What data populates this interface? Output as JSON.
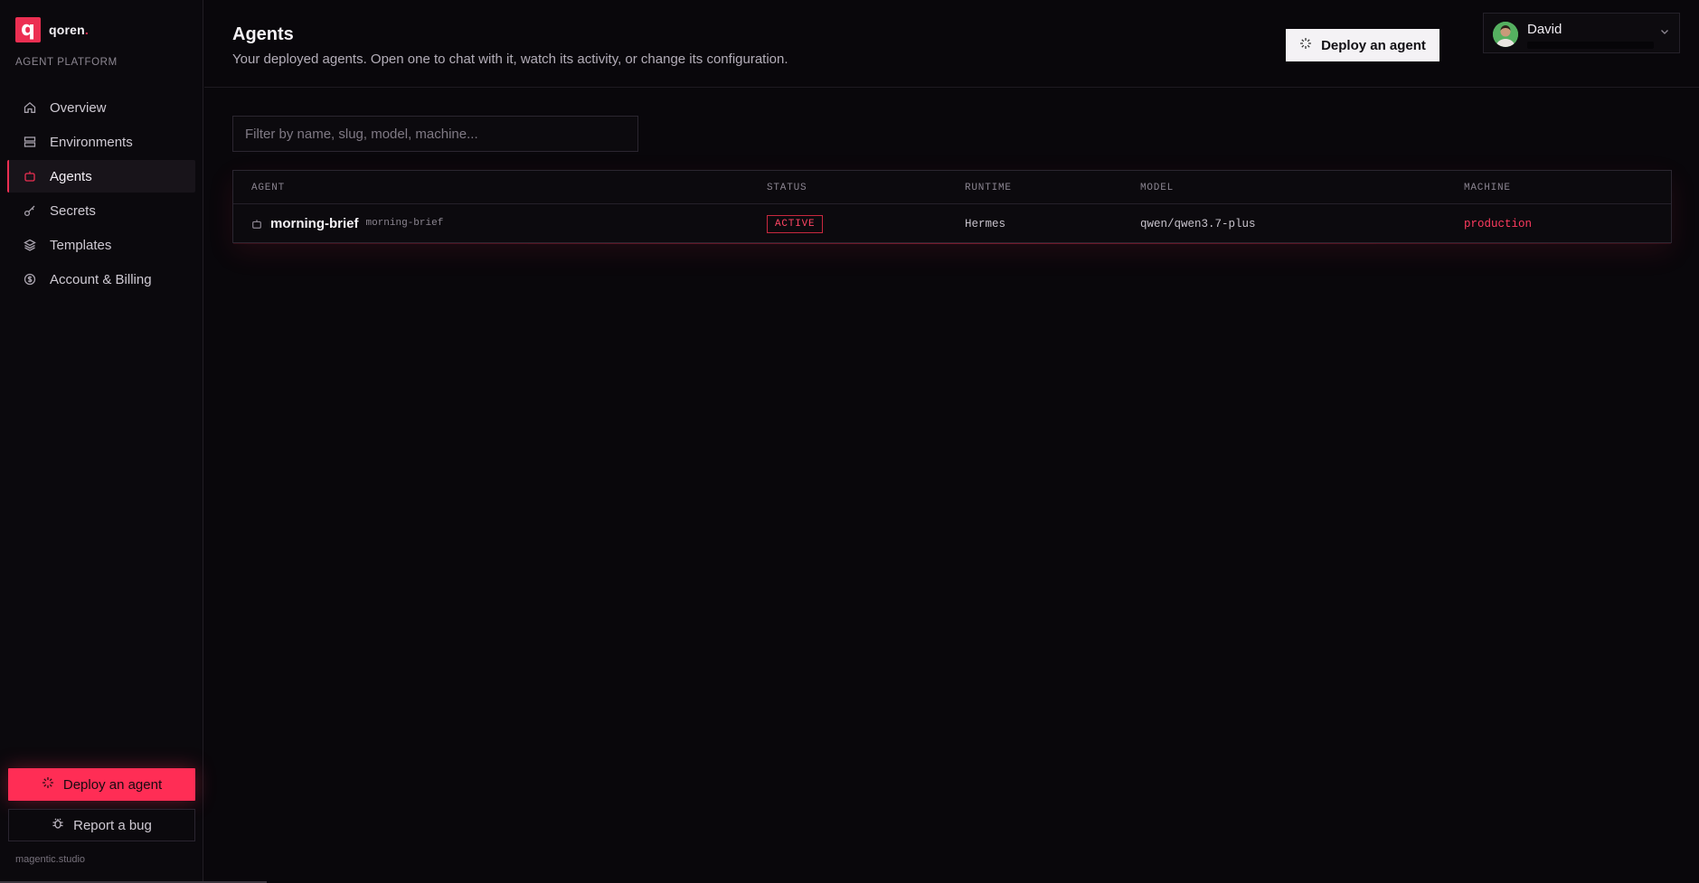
{
  "brand": {
    "logo_letter": "q",
    "name": "qoren",
    "name_suffix": ".",
    "platform_label": "AGENT PLATFORM"
  },
  "sidebar": {
    "items": [
      {
        "label": "Overview",
        "icon": "home-icon",
        "active": false
      },
      {
        "label": "Environments",
        "icon": "server-icon",
        "active": false
      },
      {
        "label": "Agents",
        "icon": "bot-icon",
        "active": true
      },
      {
        "label": "Secrets",
        "icon": "key-icon",
        "active": false
      },
      {
        "label": "Templates",
        "icon": "layers-icon",
        "active": false
      },
      {
        "label": "Account & Billing",
        "icon": "dollar-icon",
        "active": false
      }
    ],
    "deploy_label": "Deploy an agent",
    "bug_label": "Report a bug",
    "footer_domain": "magentic.studio"
  },
  "header": {
    "title": "Agents",
    "subtitle": "Your deployed agents. Open one to chat with it, watch its activity, or change its configuration.",
    "deploy_label": "Deploy an agent"
  },
  "user": {
    "name": "David"
  },
  "filter": {
    "placeholder": "Filter by name, slug, model, machine...",
    "value": ""
  },
  "table": {
    "columns": [
      "AGENT",
      "STATUS",
      "RUNTIME",
      "MODEL",
      "MACHINE"
    ],
    "rows": [
      {
        "name": "morning-brief",
        "slug": "morning-brief",
        "status": "ACTIVE",
        "runtime": "Hermes",
        "model": "qwen/qwen3.7-plus",
        "machine": "production"
      }
    ]
  },
  "colors": {
    "accent": "#ec2f52",
    "background": "#09070b",
    "sidebar": "#0b090d",
    "header_button": "#f4f2f5"
  }
}
